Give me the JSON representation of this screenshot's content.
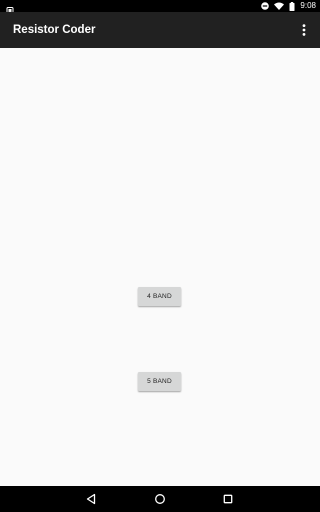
{
  "status_bar": {
    "time": "9:08",
    "icons": [
      "screenshot-icon",
      "dnd-icon",
      "wifi-icon",
      "battery-icon"
    ]
  },
  "app_bar": {
    "title": "Resistor Coder",
    "menu_icon": "overflow-menu-icon",
    "background": "#212121"
  },
  "main": {
    "buttons": [
      {
        "label": "4 BAND"
      },
      {
        "label": "5 BAND"
      }
    ]
  },
  "nav_bar": {
    "icons": [
      "back-icon",
      "home-icon",
      "recents-icon"
    ]
  }
}
